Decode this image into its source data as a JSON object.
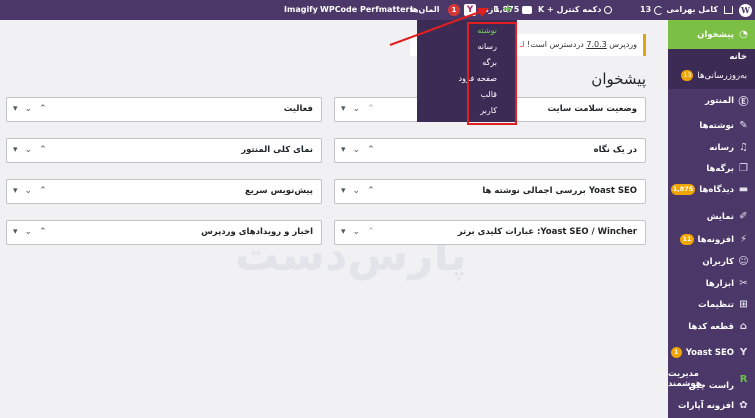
{
  "adminbar": {
    "site_name": "کامل بهرامی",
    "updates_count": "13",
    "control_panel": "دکمه کنترل + K",
    "comments_count": "1,875",
    "new_label": "تازه",
    "yoast_badge": "1",
    "elements_label": "المان‌ها",
    "perfmatters": "Perfmatters",
    "wpcode": "WPCode",
    "imagify": "Imagify"
  },
  "new_menu": {
    "items": [
      "نوشته",
      "رسانه",
      "برگه",
      "صفحه فرود",
      "قالب",
      "کاربر"
    ]
  },
  "notice": {
    "prefix": "وردپرس",
    "version": "7.0.3",
    "suffix": " دردسترس است!",
    "link_fragment": "لـ"
  },
  "page_title": "پیشخوان",
  "widgets": {
    "right": [
      "وضعیت سلامت سایت",
      "در یک نگاه",
      "Yoast SEO بررسی اجمالی نوشته ها",
      "Yoast SEO / Wincher: عبارات کلیدی برتر"
    ],
    "left": [
      "فعالیت",
      "نمای کلی المنتور",
      "پیش‌نویس سریع",
      "اخبار و رویدادهای وردپرس"
    ]
  },
  "watermark": "پارس‌دست",
  "sidebar": {
    "dashboard": "پیشخوان",
    "home": "خانه",
    "updates": "به‌روزرسانی‌ها",
    "updates_badge": "13",
    "elementor": "المنتور",
    "posts": "نوشته‌ها",
    "media": "رسانه",
    "pages": "برگه‌ها",
    "comments": "دیدگاه‌ها",
    "comments_badge": "1,875",
    "appearance": "نمایش",
    "plugins": "افزونه‌ها",
    "plugins_badge": "11",
    "users": "کاربران",
    "tools": "ابزارها",
    "settings": "تنظیمات",
    "snippets": "قطعه کدها",
    "yoast": "Yoast SEO",
    "yoast_badge": "1",
    "rankmath": "مدیریت هوشمند",
    "rankmath2": "راست چین",
    "aparat": "افزونه آپارات"
  }
}
